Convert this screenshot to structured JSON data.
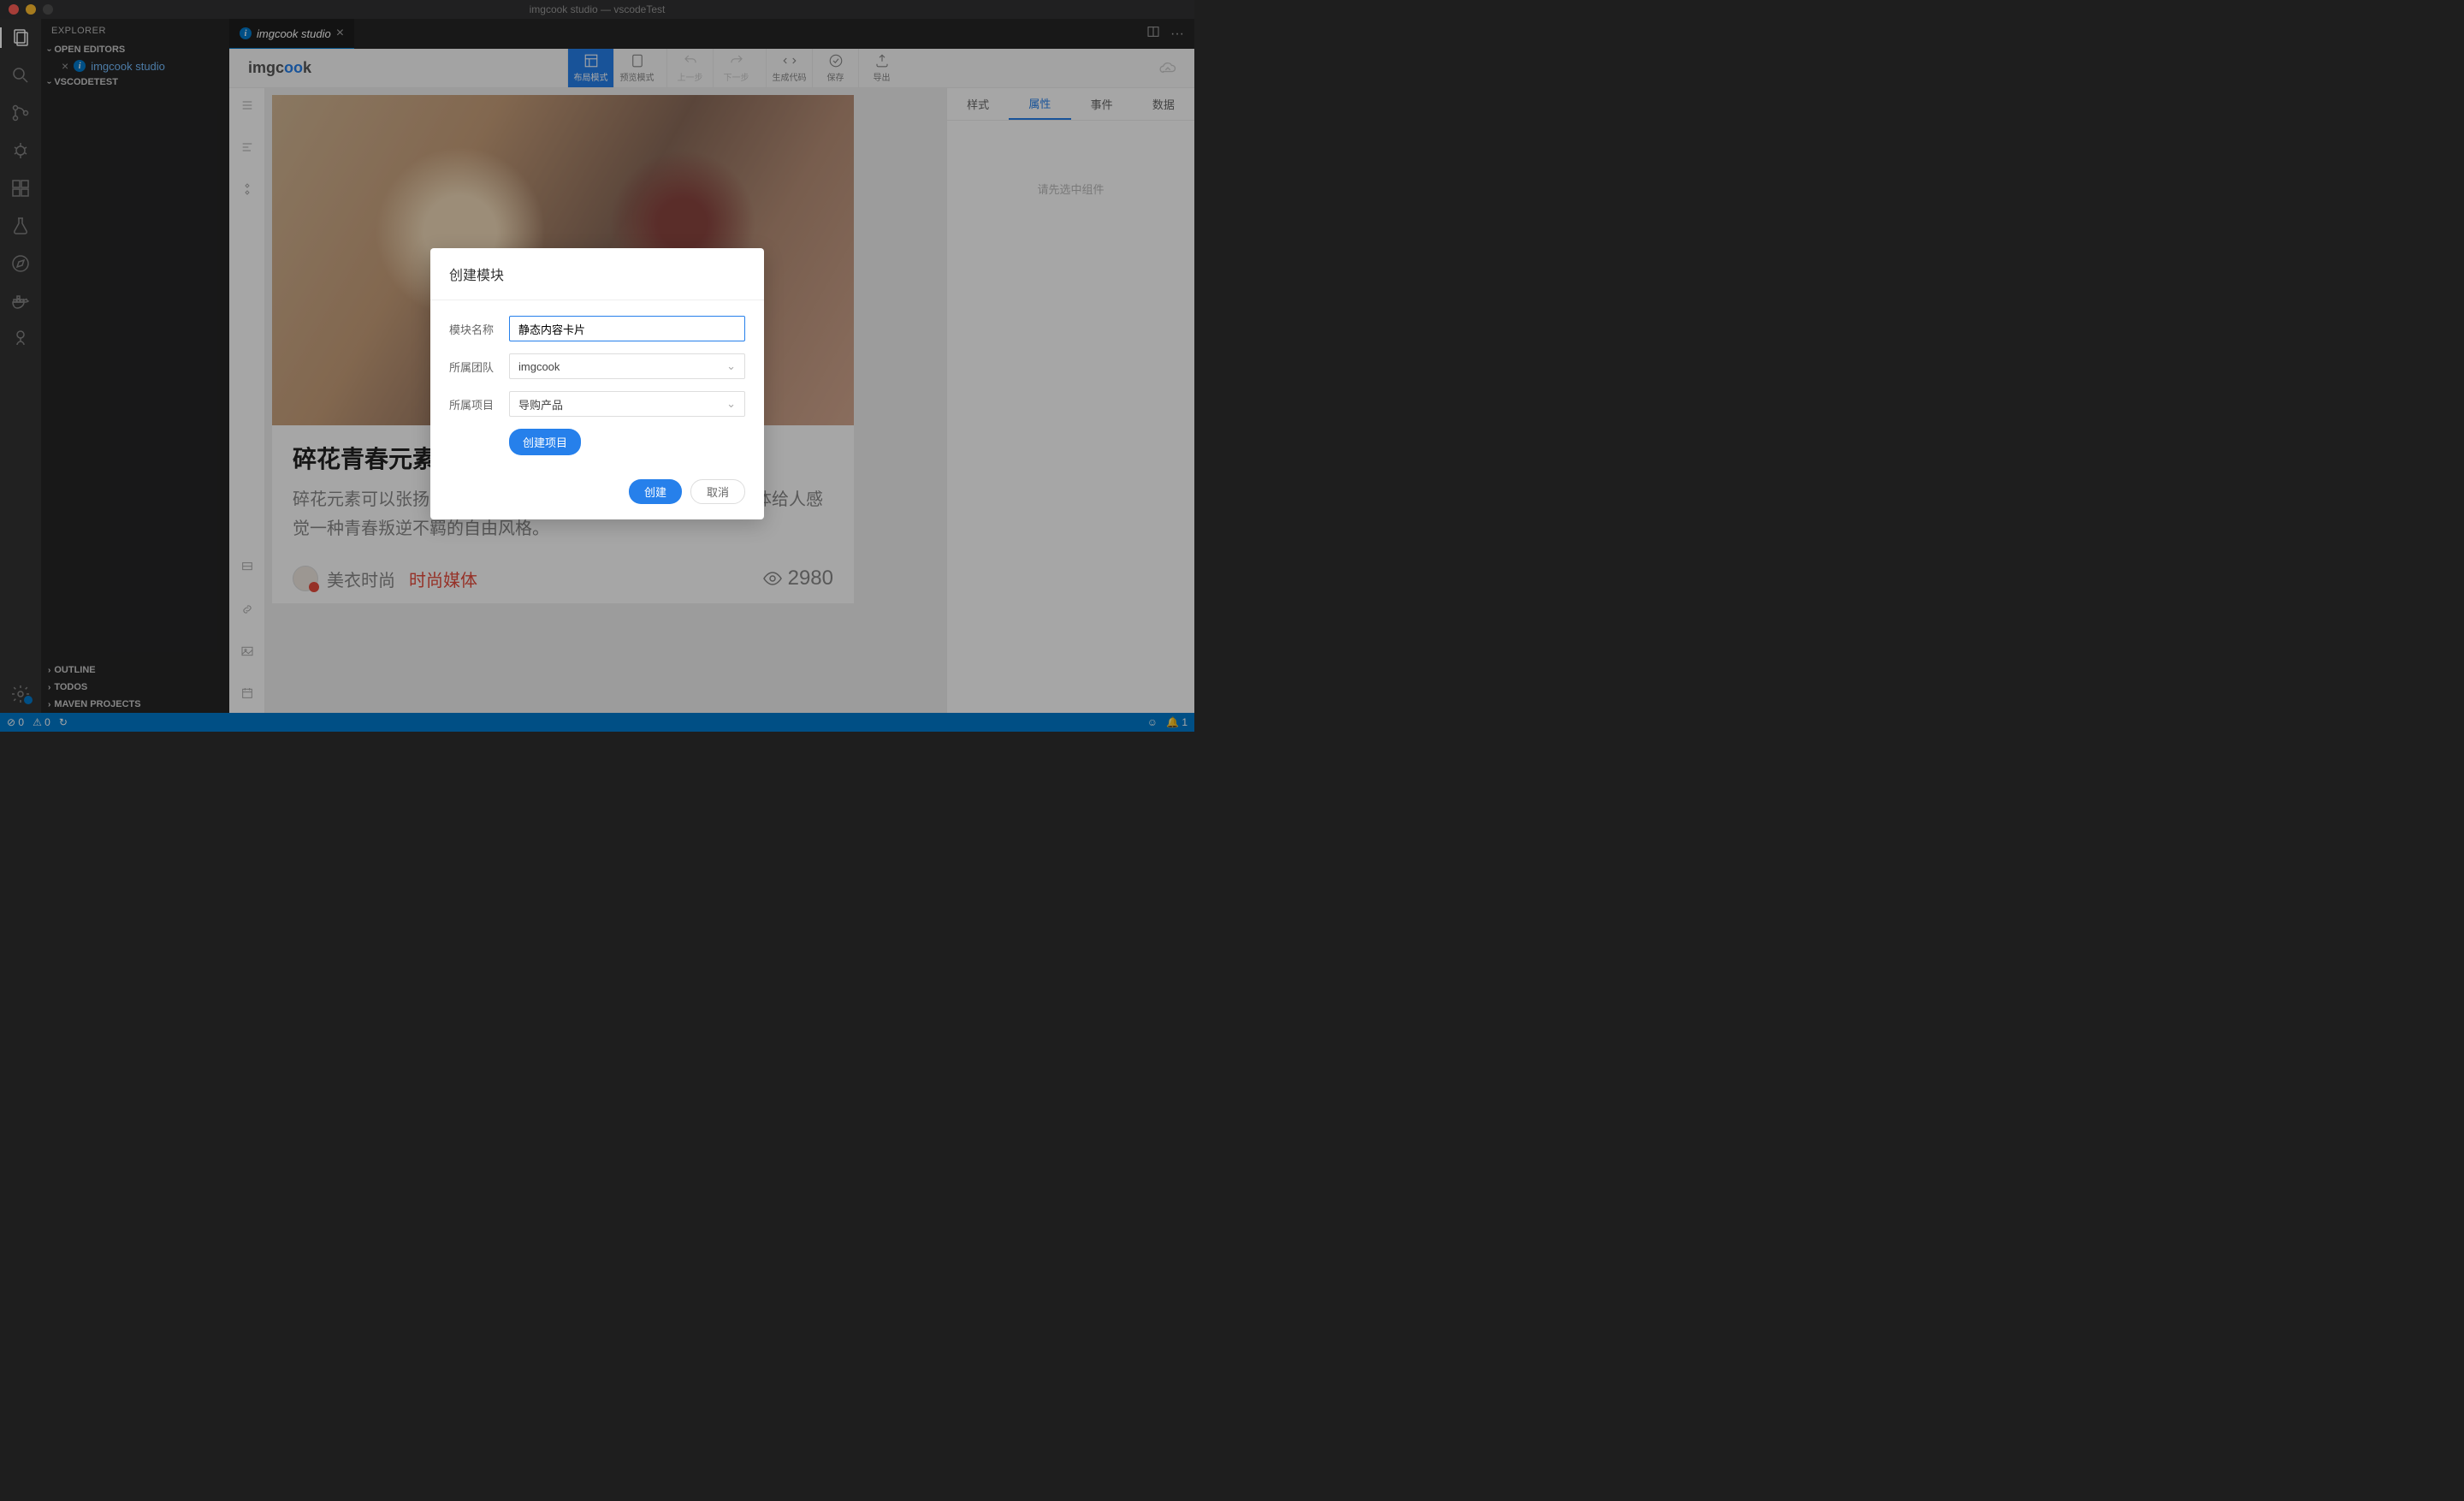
{
  "window": {
    "title": "imgcook studio — vscodeTest"
  },
  "explorer": {
    "header": "EXPLORER",
    "sections": {
      "open_editors": "OPEN EDITORS",
      "workspace": "VSCODETEST",
      "outline": "OUTLINE",
      "todos": "TODOS",
      "maven": "MAVEN PROJECTS"
    },
    "open_items": [
      {
        "label": "imgcook studio"
      }
    ]
  },
  "tabs": [
    {
      "label": "imgcook studio"
    }
  ],
  "app": {
    "logo_pre": "imgc",
    "logo_oo": "oo",
    "logo_post": "k",
    "toolbar": {
      "layout_mode": "布局模式",
      "preview_mode": "预览模式",
      "undo": "上一步",
      "redo": "下一步",
      "gen_code": "生成代码",
      "save": "保存",
      "export": "导出"
    },
    "panel_tabs": {
      "style": "样式",
      "attr": "属性",
      "event": "事件",
      "data": "数据"
    },
    "panel_hint": "请先选中组件"
  },
  "card": {
    "title": "碎花青春元素悄然走红",
    "desc": "碎花元素可以张扬自我的独特思想品格、风格和生活态度；整体给人感觉一种青春叛逆不羁的自由风格。",
    "author": "美衣时尚",
    "tag": "时尚媒体",
    "views": "2980"
  },
  "modal": {
    "title": "创建模块",
    "name_label": "模块名称",
    "name_value": "静态内容卡片",
    "team_label": "所属团队",
    "team_value": "imgcook",
    "project_label": "所属项目",
    "project_value": "导购产品",
    "create_project": "创建项目",
    "ok": "创建",
    "cancel": "取消"
  },
  "statusbar": {
    "errors": "0",
    "warnings": "0",
    "notifications": "1"
  }
}
